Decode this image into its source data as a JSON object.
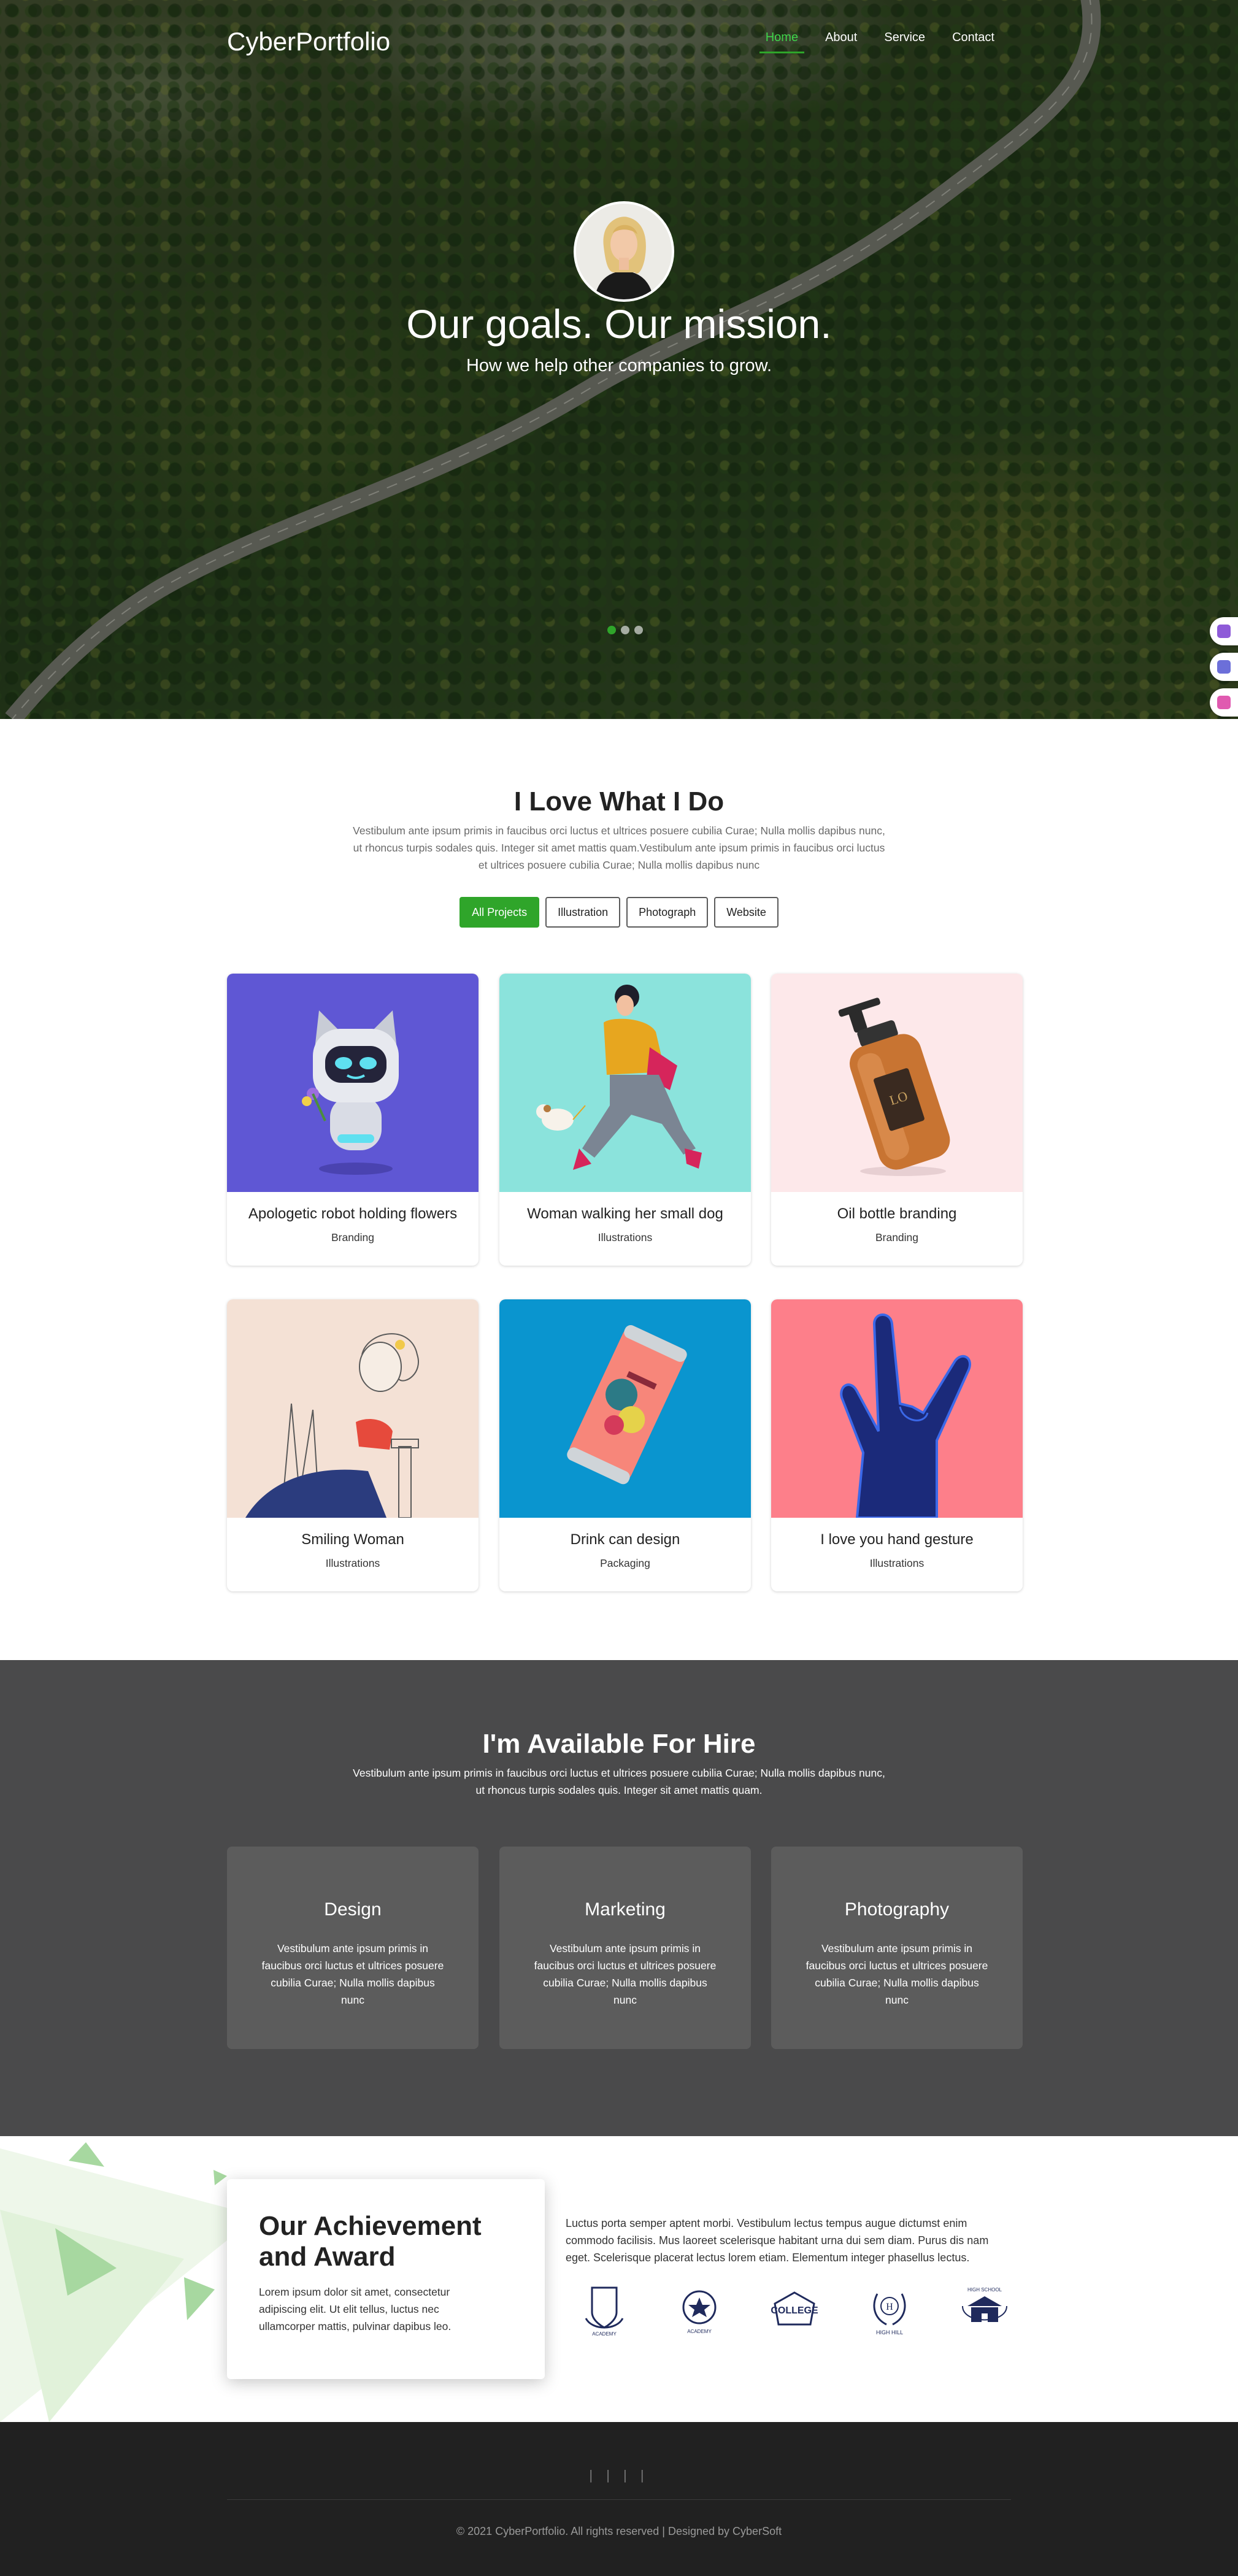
{
  "nav": {
    "brand": "CyberPortfolio",
    "items": [
      {
        "label": "Home",
        "active": true
      },
      {
        "label": "About",
        "active": false
      },
      {
        "label": "Service",
        "active": false
      },
      {
        "label": "Contact",
        "active": false
      }
    ]
  },
  "hero": {
    "title": "Our goals. Our mission.",
    "subtitle": "How we help other companies to grow.",
    "slides": 3,
    "active_slide": 1
  },
  "portfolio": {
    "title": "I Love What I Do",
    "description": "Vestibulum ante ipsum primis in faucibus orci luctus et ultrices posuere cubilia Curae; Nulla mollis dapibus nunc, ut rhoncus turpis sodales quis. Integer sit amet mattis quam.Vestibulum ante ipsum primis in faucibus orci luctus et ultrices posuere cubilia Curae; Nulla mollis dapibus nunc",
    "filters": [
      {
        "label": "All Projects",
        "active": true
      },
      {
        "label": "Illustration",
        "active": false
      },
      {
        "label": "Photograph",
        "active": false
      },
      {
        "label": "Website",
        "active": false
      }
    ],
    "projects": [
      {
        "title": "Apologetic robot holding flowers",
        "category": "Branding",
        "bg": "#5f57d4"
      },
      {
        "title": "Woman walking her small dog",
        "category": "Illustrations",
        "bg": "#8be3dc"
      },
      {
        "title": "Oil bottle branding",
        "category": "Branding",
        "bg": "#fde8ea"
      },
      {
        "title": "Smiling Woman",
        "category": "Illustrations",
        "bg": "#f4e1d5"
      },
      {
        "title": "Drink can design",
        "category": "Packaging",
        "bg": "#0a95cf"
      },
      {
        "title": "I love you hand gesture",
        "category": "Illustrations",
        "bg": "#fd7f8a"
      }
    ]
  },
  "hire": {
    "title": "I'm Available For Hire",
    "description": "Vestibulum ante ipsum primis in faucibus orci luctus et ultrices posuere cubilia Curae; Nulla mollis dapibus nunc, ut rhoncus turpis sodales quis. Integer sit amet mattis quam.",
    "services": [
      {
        "title": "Design",
        "text": "Vestibulum ante ipsum primis in faucibus orci luctus et ultrices posuere cubilia Curae; Nulla mollis dapibus nunc"
      },
      {
        "title": "Marketing",
        "text": "Vestibulum ante ipsum primis in faucibus orci luctus et ultrices posuere cubilia Curae; Nulla mollis dapibus nunc"
      },
      {
        "title": "Photography",
        "text": "Vestibulum ante ipsum primis in faucibus orci luctus et ultrices posuere cubilia Curae; Nulla mollis dapibus nunc"
      }
    ]
  },
  "achievement": {
    "title": "Our Achievement and Award",
    "description": "Lorem ipsum dolor sit amet, consectetur adipiscing elit. Ut elit tellus, luctus nec ullamcorper mattis, pulvinar dapibus leo.",
    "text": "Luctus porta semper aptent morbi. Vestibulum lectus tempus augue dictumst enim commodo facilisis. Mus laoreet scelerisque habitant urna dui sem diam. Purus dis nam eget. Scelerisque placerat lectus lorem etiam. Elementum integer phasellus lectus.",
    "logos": [
      {
        "icon": "shield-crest-logo",
        "text": "ACADEMY"
      },
      {
        "icon": "star-emblem-logo",
        "text": "ACADEMY"
      },
      {
        "icon": "college-badge-logo",
        "text": "COLLEGE"
      },
      {
        "icon": "laurel-h-logo",
        "text": "HIGH HILL"
      },
      {
        "icon": "school-building-logo",
        "text": "HIGH SCHOOL"
      }
    ]
  },
  "footer": {
    "social": "| | | |",
    "copyright": "© 2021 CyberPortfolio. All rights reserved | Designed by CyberSoft"
  },
  "colors": {
    "accent": "#2fa52a",
    "hire_bg": "#4a4a4b",
    "footer_bg": "#212121"
  }
}
